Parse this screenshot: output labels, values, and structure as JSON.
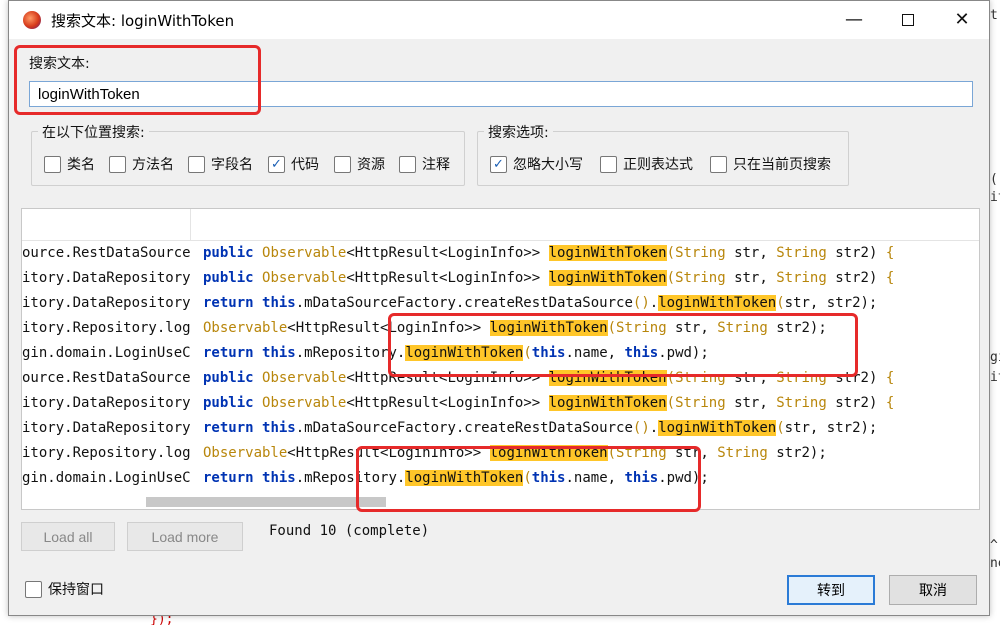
{
  "dialog": {
    "title": "搜索文本: loginWithToken",
    "window_buttons": {
      "minimize": "—",
      "close": "✕"
    }
  },
  "search": {
    "label": "搜索文本:",
    "value": "loginWithToken"
  },
  "search_in": {
    "label": "在以下位置搜索:",
    "options": [
      {
        "label": "类名",
        "checked": false
      },
      {
        "label": "方法名",
        "checked": false
      },
      {
        "label": "字段名",
        "checked": false
      },
      {
        "label": "代码",
        "checked": true
      },
      {
        "label": "资源",
        "checked": false
      },
      {
        "label": "注释",
        "checked": false
      }
    ]
  },
  "search_options": {
    "label": "搜索选项:",
    "options": [
      {
        "label": "忽略大小写",
        "checked": true
      },
      {
        "label": "正则表达式",
        "checked": false
      },
      {
        "label": "只在当前页搜索",
        "checked": false
      }
    ]
  },
  "results": {
    "class_column": [
      "ource.RestDataSource",
      "itory.DataRepository",
      "itory.DataRepository",
      "itory.Repository.log",
      "gin.domain.LoginUseC",
      "ource.RestDataSource",
      "itory.DataRepository",
      "itory.DataRepository",
      "itory.Repository.log",
      "gin.domain.LoginUseC"
    ],
    "code_rows": [
      [
        [
          "kw",
          "public"
        ],
        [
          "t",
          " "
        ],
        [
          "ty",
          "Observable"
        ],
        [
          "t",
          "<HttpResult<LoginInfo>> "
        ],
        [
          "hl",
          "loginWithToken"
        ],
        [
          "ty",
          "("
        ],
        [
          "ty",
          "String"
        ],
        [
          "t",
          " str, "
        ],
        [
          "ty",
          "String"
        ],
        [
          "t",
          " str2) "
        ],
        [
          "ty",
          "{"
        ]
      ],
      [
        [
          "kw",
          "public"
        ],
        [
          "t",
          " "
        ],
        [
          "ty",
          "Observable"
        ],
        [
          "t",
          "<HttpResult<LoginInfo>> "
        ],
        [
          "hl",
          "loginWithToken"
        ],
        [
          "ty",
          "("
        ],
        [
          "ty",
          "String"
        ],
        [
          "t",
          " str, "
        ],
        [
          "ty",
          "String"
        ],
        [
          "t",
          " str2) "
        ],
        [
          "ty",
          "{"
        ]
      ],
      [
        [
          "kw",
          "return"
        ],
        [
          "t",
          " "
        ],
        [
          "kw",
          "this"
        ],
        [
          "t",
          ".mDataSourceFactory.createRestDataSource"
        ],
        [
          "ty",
          "()"
        ],
        [
          "t",
          "."
        ],
        [
          "hl",
          "loginWithToken"
        ],
        [
          "ty",
          "("
        ],
        [
          "t",
          "str, str2);"
        ]
      ],
      [
        [
          "ty",
          "Observable"
        ],
        [
          "t",
          "<HttpResult<LoginInfo>> "
        ],
        [
          "hl",
          "loginWithToken"
        ],
        [
          "ty",
          "("
        ],
        [
          "ty",
          "String"
        ],
        [
          "t",
          " str, "
        ],
        [
          "ty",
          "String"
        ],
        [
          "t",
          " str2);"
        ]
      ],
      [
        [
          "kw",
          "return"
        ],
        [
          "t",
          " "
        ],
        [
          "kw",
          "this"
        ],
        [
          "t",
          ".mRepository."
        ],
        [
          "hl",
          "loginWithToken"
        ],
        [
          "ty",
          "("
        ],
        [
          "kw",
          "this"
        ],
        [
          "t",
          ".name, "
        ],
        [
          "kw",
          "this"
        ],
        [
          "t",
          ".pwd);"
        ]
      ],
      [
        [
          "kw",
          "public"
        ],
        [
          "t",
          " "
        ],
        [
          "ty",
          "Observable"
        ],
        [
          "t",
          "<HttpResult<LoginInfo>> "
        ],
        [
          "hl",
          "loginWithToken"
        ],
        [
          "ty",
          "("
        ],
        [
          "ty",
          "String"
        ],
        [
          "t",
          " str, "
        ],
        [
          "ty",
          "String"
        ],
        [
          "t",
          " str2) "
        ],
        [
          "ty",
          "{"
        ]
      ],
      [
        [
          "kw",
          "public"
        ],
        [
          "t",
          " "
        ],
        [
          "ty",
          "Observable"
        ],
        [
          "t",
          "<HttpResult<LoginInfo>> "
        ],
        [
          "hl",
          "loginWithToken"
        ],
        [
          "ty",
          "("
        ],
        [
          "ty",
          "String"
        ],
        [
          "t",
          " str, "
        ],
        [
          "ty",
          "String"
        ],
        [
          "t",
          " str2) "
        ],
        [
          "ty",
          "{"
        ]
      ],
      [
        [
          "kw",
          "return"
        ],
        [
          "t",
          " "
        ],
        [
          "kw",
          "this"
        ],
        [
          "t",
          ".mDataSourceFactory.createRestDataSource"
        ],
        [
          "ty",
          "()"
        ],
        [
          "t",
          "."
        ],
        [
          "hl",
          "loginWithToken"
        ],
        [
          "ty",
          "("
        ],
        [
          "t",
          "str, str2);"
        ]
      ],
      [
        [
          "ty",
          "Observable"
        ],
        [
          "t",
          "<HttpResult<LoginInfo>> "
        ],
        [
          "hl",
          "loginWithToken"
        ],
        [
          "ty",
          "("
        ],
        [
          "ty",
          "String"
        ],
        [
          "t",
          " str, "
        ],
        [
          "ty",
          "String"
        ],
        [
          "t",
          " str2);"
        ]
      ],
      [
        [
          "kw",
          "return"
        ],
        [
          "t",
          " "
        ],
        [
          "kw",
          "this"
        ],
        [
          "t",
          ".mRepository."
        ],
        [
          "hl",
          "loginWithToken"
        ],
        [
          "ty",
          "("
        ],
        [
          "kw",
          "this"
        ],
        [
          "t",
          ".name, "
        ],
        [
          "kw",
          "this"
        ],
        [
          "t",
          ".pwd);"
        ]
      ]
    ]
  },
  "buttons": {
    "load_all": "Load all",
    "load_more": "Load more",
    "goto": "转到",
    "cancel": "取消"
  },
  "status": {
    "found": "Found 10 (complete)"
  },
  "keep_window": {
    "label": "保持窗口",
    "checked": false
  },
  "background_editor": {
    "right_fragments": [
      "t",
      "(r",
      "it",
      "gi",
      "it",
      "^,",
      "ne"
    ],
    "bottom_fragment": "});"
  },
  "colors": {
    "highlight": "#ffc629",
    "keyword": "#0033b3",
    "type": "#b8860b",
    "annotation": "#e62a2a"
  }
}
